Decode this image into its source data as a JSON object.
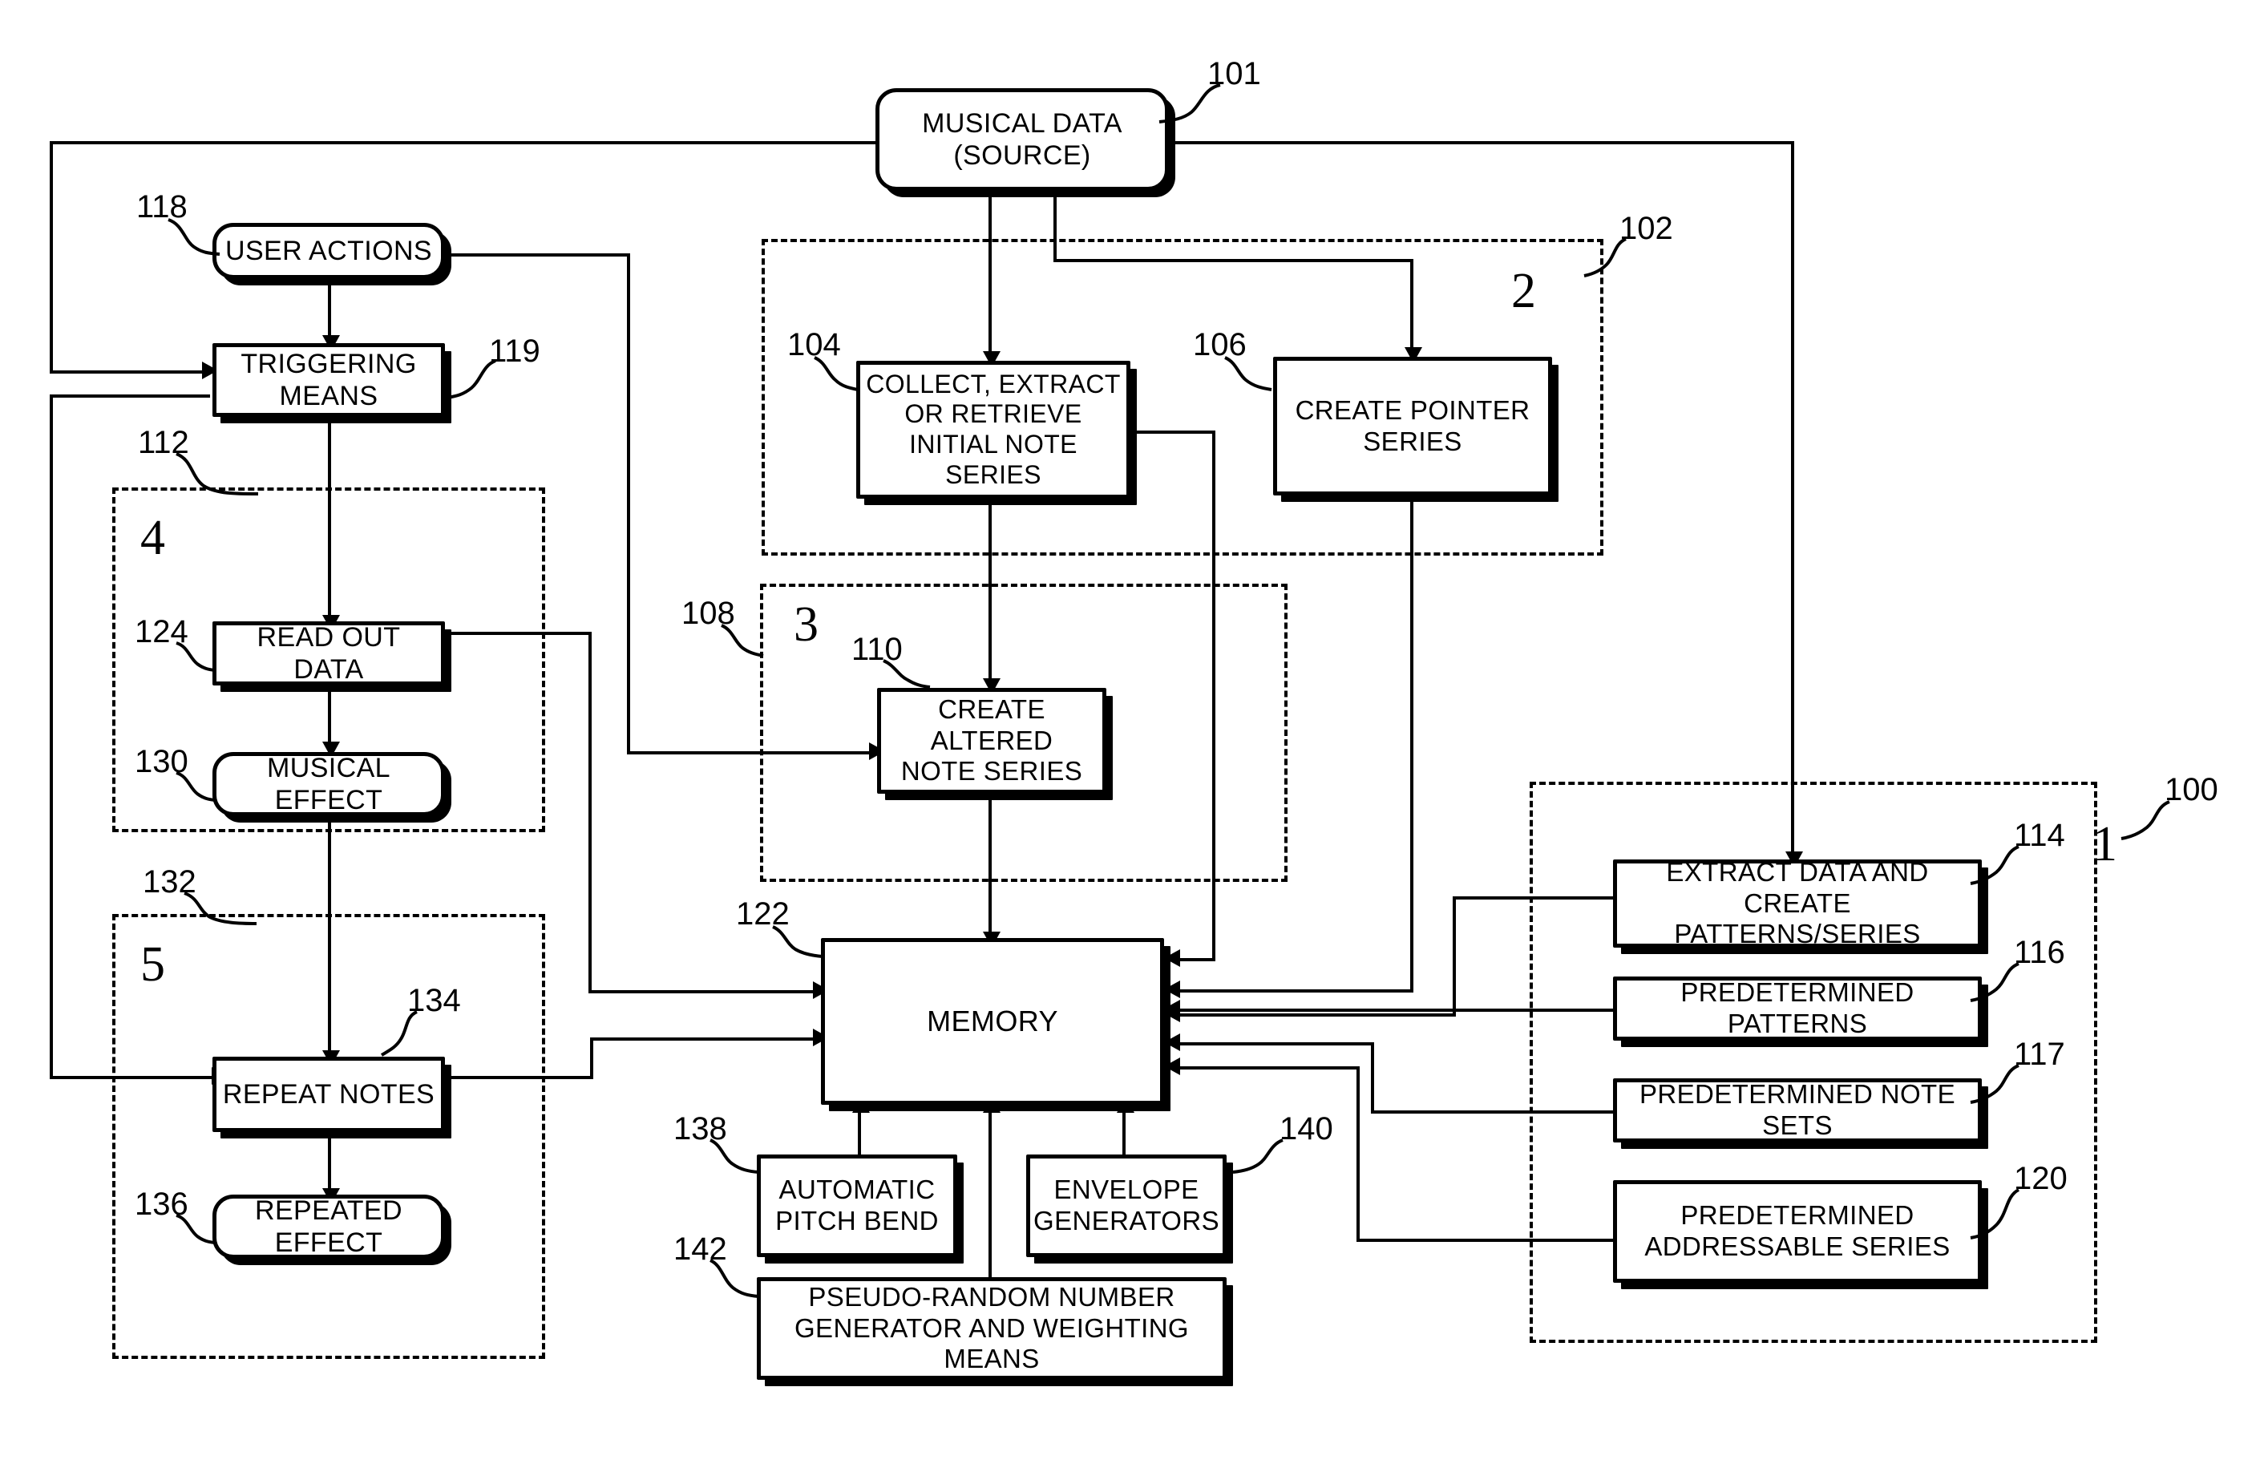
{
  "figure": {
    "type": "patent-block-diagram",
    "groups": [
      {
        "id": "g2",
        "label": "2",
        "ref": "102"
      },
      {
        "id": "g3",
        "label": "3",
        "ref": "108"
      },
      {
        "id": "g4",
        "label": "4",
        "ref": "112"
      },
      {
        "id": "g5",
        "label": "5",
        "ref": "132"
      },
      {
        "id": "g1",
        "label": "1",
        "ref": "100"
      }
    ],
    "nodes": [
      {
        "id": "n101",
        "ref": "101",
        "label": "MUSICAL DATA\n(SOURCE)",
        "shape": "round"
      },
      {
        "id": "n118",
        "ref": "118",
        "label": "USER ACTIONS",
        "shape": "round"
      },
      {
        "id": "n119",
        "ref": "119",
        "label": "TRIGGERING\nMEANS",
        "shape": "square"
      },
      {
        "id": "n124",
        "ref": "124",
        "label": "READ OUT DATA",
        "shape": "square"
      },
      {
        "id": "n130",
        "ref": "130",
        "label": "MUSICAL EFFECT",
        "shape": "round"
      },
      {
        "id": "n134",
        "ref": "134",
        "label": "REPEAT NOTES",
        "shape": "square"
      },
      {
        "id": "n136",
        "ref": "136",
        "label": "REPEATED EFFECT",
        "shape": "round"
      },
      {
        "id": "n104",
        "ref": "104",
        "label": "COLLECT, EXTRACT\nOR RETRIEVE\nINITIAL NOTE SERIES",
        "shape": "square"
      },
      {
        "id": "n106",
        "ref": "106",
        "label": "CREATE POINTER\nSERIES",
        "shape": "square"
      },
      {
        "id": "n110",
        "ref": "110",
        "label": "CREATE ALTERED\nNOTE SERIES",
        "shape": "square"
      },
      {
        "id": "n122",
        "ref": "122",
        "label": "MEMORY",
        "shape": "square"
      },
      {
        "id": "n138",
        "ref": "138",
        "label": "AUTOMATIC\nPITCH BEND",
        "shape": "square"
      },
      {
        "id": "n140",
        "ref": "140",
        "label": "ENVELOPE\nGENERATORS",
        "shape": "square"
      },
      {
        "id": "n142",
        "ref": "142",
        "label": "PSEUDO-RANDOM NUMBER\nGENERATOR AND WEIGHTING MEANS",
        "shape": "square"
      },
      {
        "id": "n114",
        "ref": "114",
        "label": "EXTRACT DATA AND CREATE\nPATTERNS/SERIES",
        "shape": "square"
      },
      {
        "id": "n116",
        "ref": "116",
        "label": "PREDETERMINED PATTERNS",
        "shape": "square"
      },
      {
        "id": "n117",
        "ref": "117",
        "label": "PREDETERMINED NOTE SETS",
        "shape": "square"
      },
      {
        "id": "n120",
        "ref": "120",
        "label": "PREDETERMINED\nADDRESSABLE SERIES",
        "shape": "square"
      }
    ]
  },
  "labels": {
    "musical_data": "MUSICAL DATA\n(SOURCE)",
    "user_actions": "USER ACTIONS",
    "triggering_means": "TRIGGERING\nMEANS",
    "read_out_data": "READ OUT DATA",
    "musical_effect": "MUSICAL EFFECT",
    "repeat_notes": "REPEAT NOTES",
    "repeated_effect": "REPEATED EFFECT",
    "collect_extract": "COLLECT, EXTRACT\nOR RETRIEVE\nINITIAL NOTE SERIES",
    "create_pointer_series": "CREATE POINTER\nSERIES",
    "create_altered_note_series": "CREATE ALTERED\nNOTE SERIES",
    "memory": "MEMORY",
    "automatic_pitch_bend": "AUTOMATIC\nPITCH BEND",
    "envelope_generators": "ENVELOPE\nGENERATORS",
    "pseudo_random": "PSEUDO-RANDOM NUMBER\nGENERATOR AND WEIGHTING MEANS",
    "extract_data": "EXTRACT DATA AND CREATE\nPATTERNS/SERIES",
    "predetermined_patterns": "PREDETERMINED PATTERNS",
    "predetermined_note_sets": "PREDETERMINED NOTE SETS",
    "predetermined_addressable_series": "PREDETERMINED\nADDRESSABLE SERIES"
  },
  "refs": {
    "r100": "100",
    "r101": "101",
    "r102": "102",
    "r104": "104",
    "r106": "106",
    "r108": "108",
    "r110": "110",
    "r112": "112",
    "r114": "114",
    "r116": "116",
    "r117": "117",
    "r118": "118",
    "r119": "119",
    "r120": "120",
    "r122": "122",
    "r124": "124",
    "r130": "130",
    "r132": "132",
    "r134": "134",
    "r136": "136",
    "r138": "138",
    "r140": "140",
    "r142": "142"
  },
  "group_labels": {
    "g1": "1",
    "g2": "2",
    "g3": "3",
    "g4": "4",
    "g5": "5"
  },
  "colors": {
    "ink": "#000000",
    "paper": "#ffffff"
  }
}
